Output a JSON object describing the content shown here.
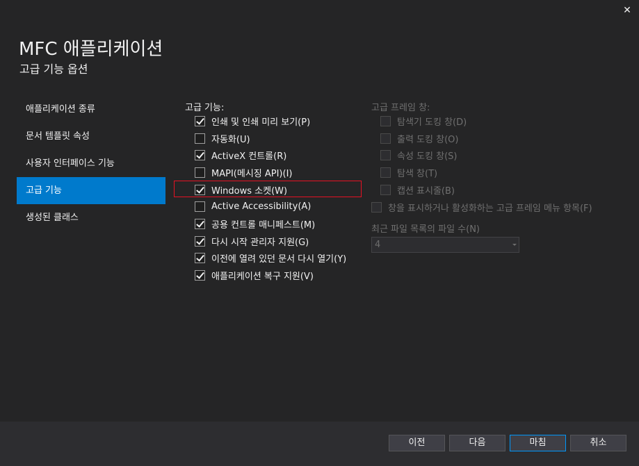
{
  "window": {
    "close_glyph": "✕",
    "title": "MFC 애플리케이션",
    "subtitle": "고급 기능 옵션"
  },
  "nav": {
    "items": [
      {
        "label": "애플리케이션 종류"
      },
      {
        "label": "문서 템플릿 속성"
      },
      {
        "label": "사용자 인터페이스 기능"
      },
      {
        "label": "고급 기능",
        "active": true
      },
      {
        "label": "생성된 클래스"
      }
    ]
  },
  "advanced": {
    "label": "고급 기능:",
    "options": [
      {
        "label": "인쇄 및 인쇄 미리 보기(P)",
        "checked": true
      },
      {
        "label": "자동화(U)",
        "checked": false
      },
      {
        "label": "ActiveX 컨트롤(R)",
        "checked": true
      },
      {
        "label": "MAPI(메시징 API)(I)",
        "checked": false
      },
      {
        "label": "Windows 소켓(W)",
        "checked": true
      },
      {
        "label": "Active Accessibility(A)",
        "checked": false
      },
      {
        "label": "공용 컨트롤 매니페스트(M)",
        "checked": true
      },
      {
        "label": "다시 시작 관리자 지원(G)",
        "checked": true
      },
      {
        "label": "이전에 열려 있던 문서 다시 열기(Y)",
        "checked": true
      },
      {
        "label": "애플리케이션 복구 지원(V)",
        "checked": true
      }
    ]
  },
  "frame_panes": {
    "label": "고급 프레임 창:",
    "options": [
      {
        "label": "탐색기 도킹 창(D)",
        "checked": false
      },
      {
        "label": "출력 도킹 창(O)",
        "checked": false
      },
      {
        "label": "속성 도킹 창(S)",
        "checked": false
      },
      {
        "label": "탐색 창(T)",
        "checked": false
      },
      {
        "label": "캡션 표시줄(B)",
        "checked": false
      }
    ],
    "menu_option": {
      "label": "창을 표시하거나 활성화하는 고급 프레임 메뉴 항목(F)",
      "checked": false
    }
  },
  "mru": {
    "label": "최근 파일 목록의 파일 수(N)",
    "value": "4"
  },
  "footer": {
    "prev": "이전",
    "next": "다음",
    "finish": "마침",
    "cancel": "취소"
  },
  "colors": {
    "background": "#252526",
    "accent": "#007acc",
    "highlight": "#e81123"
  }
}
